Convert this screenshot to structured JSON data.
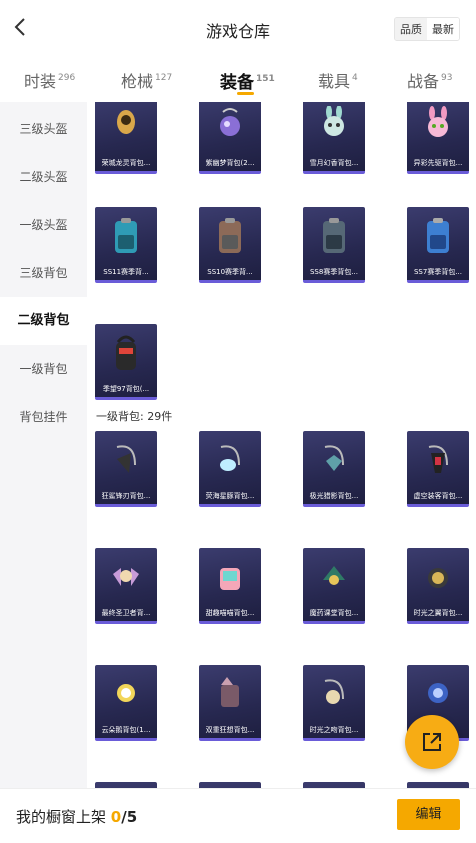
{
  "header": {
    "title": "游戏仓库",
    "sort_quality": "品质",
    "sort_latest": "最新"
  },
  "tabs": [
    {
      "label": "时装",
      "count": "296"
    },
    {
      "label": "枪械",
      "count": "127"
    },
    {
      "label": "装备",
      "count": "151"
    },
    {
      "label": "载具",
      "count": "4"
    },
    {
      "label": "战备",
      "count": "93"
    }
  ],
  "sidebar": [
    "三级头盔",
    "二级头盔",
    "一级头盔",
    "三级背包",
    "二级背包",
    "一级背包",
    "背包挂件"
  ],
  "sections": {
    "lvl1_backpack": "一级背包: 29件"
  },
  "items": {
    "row0": [
      "荣城龙灵背包...",
      "紫幽梦背包(2...",
      "雪月幻香背包...",
      "异彩先驱背包..."
    ],
    "row1": [
      "SS11赛季背...",
      "SS10赛季背...",
      "SS8赛季背包...",
      "SS7赛季背包..."
    ],
    "row2": [
      "季望97背包(..."
    ],
    "row3": [
      "狂鲨锋刃背包...",
      "荧海星豚背包...",
      "极光猎影背包...",
      "虚空装客背包..."
    ],
    "row4": [
      "最终圣卫者背...",
      "甜趣喵喵背包...",
      "魔药课堂背包...",
      "时光之翼背包..."
    ],
    "row5": [
      "云朵鹅背包(1...",
      "双重狂想背包...",
      "时光之吻背包...",
      ""
    ]
  },
  "bottom": {
    "shelf_label": "我的橱窗上架",
    "shelf_count": "0",
    "shelf_total": "/5",
    "edit_label": "编辑"
  },
  "colors": {
    "accent": "#f5a800",
    "card_bg": "#2b2c58",
    "card_border": "#6a5cd8"
  }
}
